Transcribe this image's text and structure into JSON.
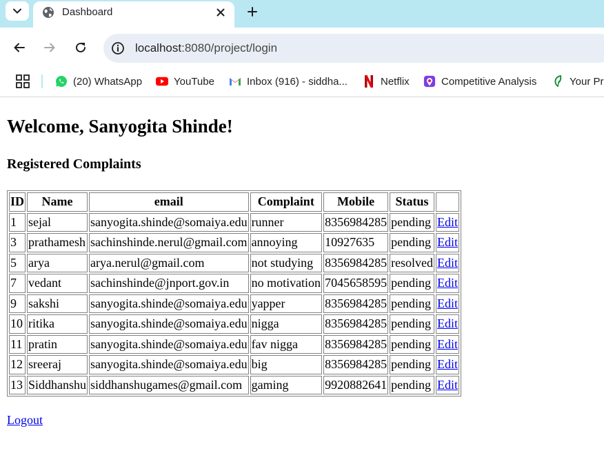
{
  "browser": {
    "tab_title": "Dashboard",
    "url_host": "localhost",
    "url_path": ":8080/project/login",
    "accent_color": "#b9e8f3"
  },
  "bookmarks": [
    {
      "label": "(20) WhatsApp",
      "icon": "whatsapp-icon"
    },
    {
      "label": "YouTube",
      "icon": "youtube-icon"
    },
    {
      "label": "Inbox (916) - siddha...",
      "icon": "gmail-icon"
    },
    {
      "label": "Netflix",
      "icon": "netflix-icon"
    },
    {
      "label": "Competitive Analysis",
      "icon": "competitive-analysis-icon"
    },
    {
      "label": "Your Pr",
      "icon": "leaf-icon"
    }
  ],
  "page": {
    "welcome": "Welcome, Sanyogita Shinde!",
    "section_title": "Registered Complaints",
    "logout_label": "Logout"
  },
  "table": {
    "headers": [
      "ID",
      "Name",
      "email",
      "Complaint",
      "Mobile",
      "Status",
      ""
    ],
    "edit_label": "Edit",
    "rows": [
      {
        "id": "1",
        "name": "sejal",
        "email": "sanyogita.shinde@somaiya.edu",
        "complaint": "runner",
        "mobile": "8356984285",
        "status": "pending"
      },
      {
        "id": "3",
        "name": "prathamesh",
        "email": "sachinshinde.nerul@gmail.com",
        "complaint": "annoying",
        "mobile": "10927635",
        "status": "pending"
      },
      {
        "id": "5",
        "name": "arya",
        "email": "arya.nerul@gmail.com",
        "complaint": "not studying",
        "mobile": "8356984285",
        "status": "resolved"
      },
      {
        "id": "7",
        "name": "vedant",
        "email": "sachinshinde@jnport.gov.in",
        "complaint": "no motivation",
        "mobile": "7045658595",
        "status": "pending"
      },
      {
        "id": "9",
        "name": "sakshi",
        "email": "sanyogita.shinde@somaiya.edu",
        "complaint": "yapper",
        "mobile": "8356984285",
        "status": "pending"
      },
      {
        "id": "10",
        "name": "ritika",
        "email": "sanyogita.shinde@somaiya.edu",
        "complaint": "nigga",
        "mobile": "8356984285",
        "status": "pending"
      },
      {
        "id": "11",
        "name": "pratin",
        "email": "sanyogita.shinde@somaiya.edu",
        "complaint": "fav nigga",
        "mobile": "8356984285",
        "status": "pending"
      },
      {
        "id": "12",
        "name": "sreeraj",
        "email": "sanyogita.shinde@somaiya.edu",
        "complaint": "big",
        "mobile": "8356984285",
        "status": "pending"
      },
      {
        "id": "13",
        "name": "Siddhanshu",
        "email": "siddhanshugames@gmail.com",
        "complaint": "gaming",
        "mobile": "9920882641",
        "status": "pending"
      }
    ]
  }
}
